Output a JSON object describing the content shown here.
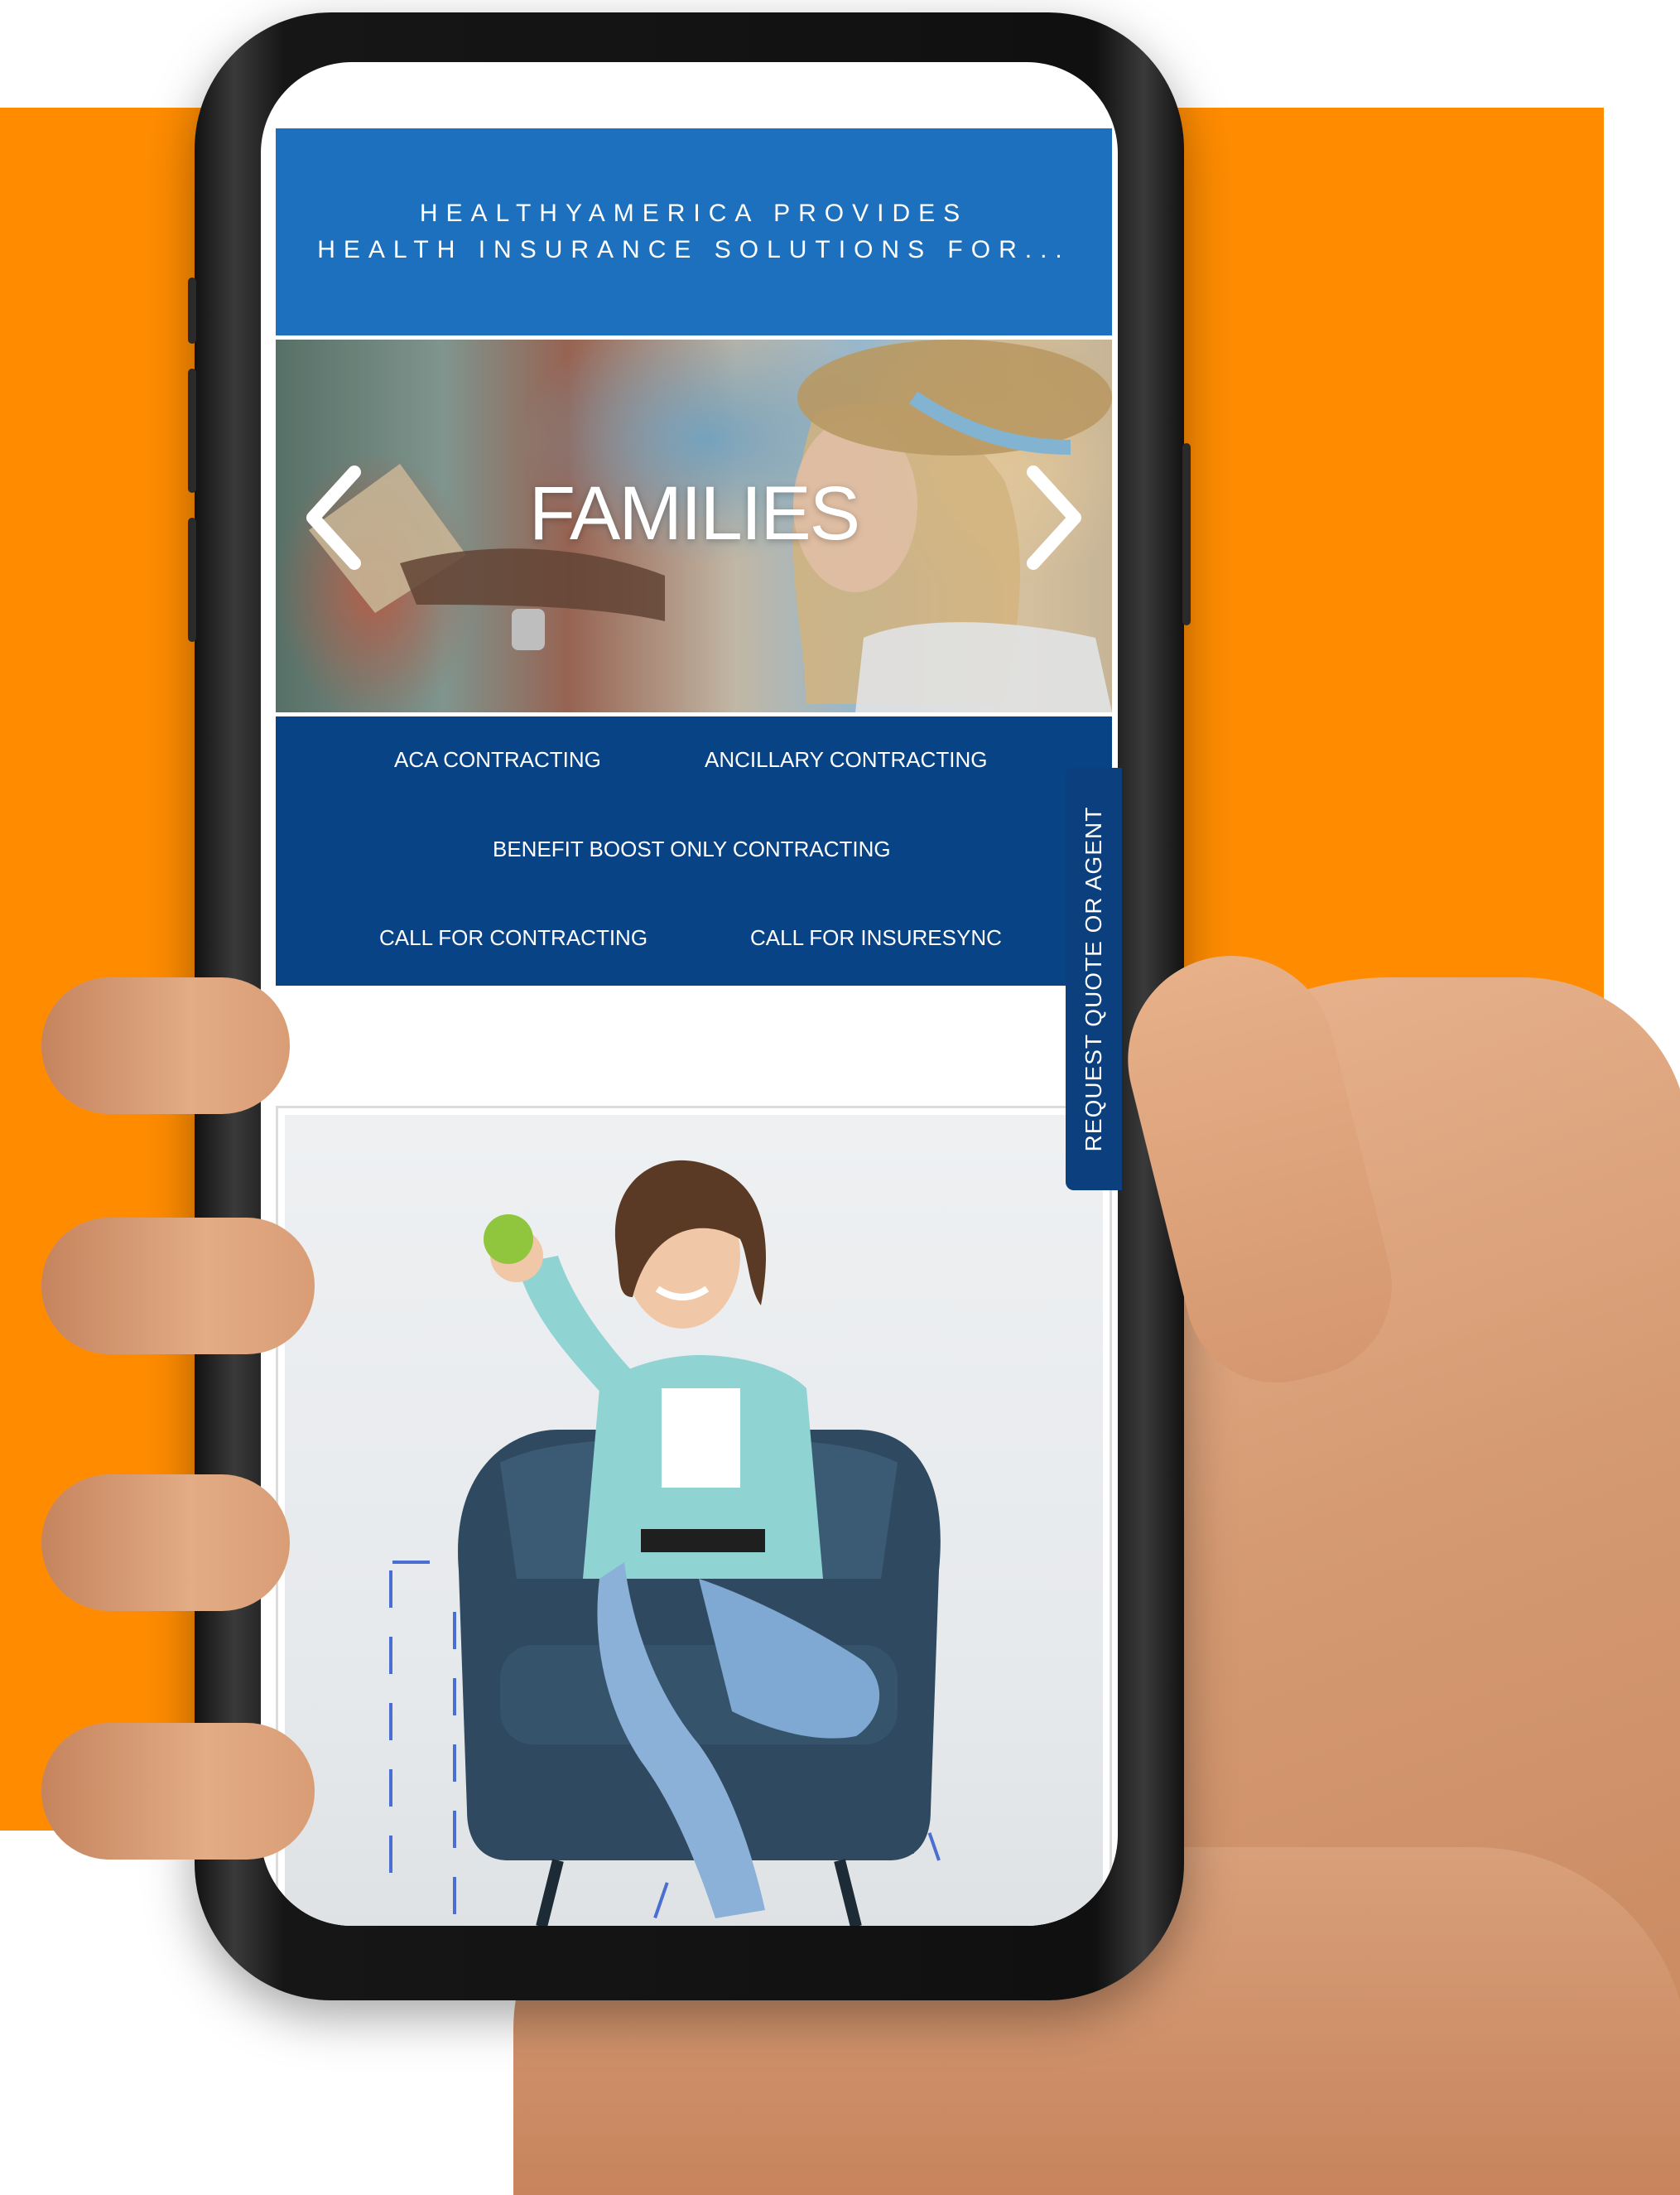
{
  "colors": {
    "background_accent": "#FF8C00",
    "header_banner": "#1D70BD",
    "links_panel": "#084386",
    "request_tab": "#0B3F7D"
  },
  "header": {
    "line1": "HEALTHYAMERICA PROVIDES",
    "line2": "HEALTH INSURANCE SOLUTIONS FOR..."
  },
  "hero": {
    "title": "FAMILIES",
    "prev_icon": "chevron-left-icon",
    "next_icon": "chevron-right-icon"
  },
  "links": {
    "aca": "ACA CONTRACTING",
    "ancillary": "ANCILLARY CONTRACTING",
    "benefit_boost": "BENEFIT BOOST ONLY CONTRACTING",
    "call_contracting": "CALL FOR CONTRACTING",
    "call_insuresync": "CALL FOR INSURESYNC"
  },
  "request_tab": {
    "label": "REQUEST QUOTE OR AGENT"
  }
}
